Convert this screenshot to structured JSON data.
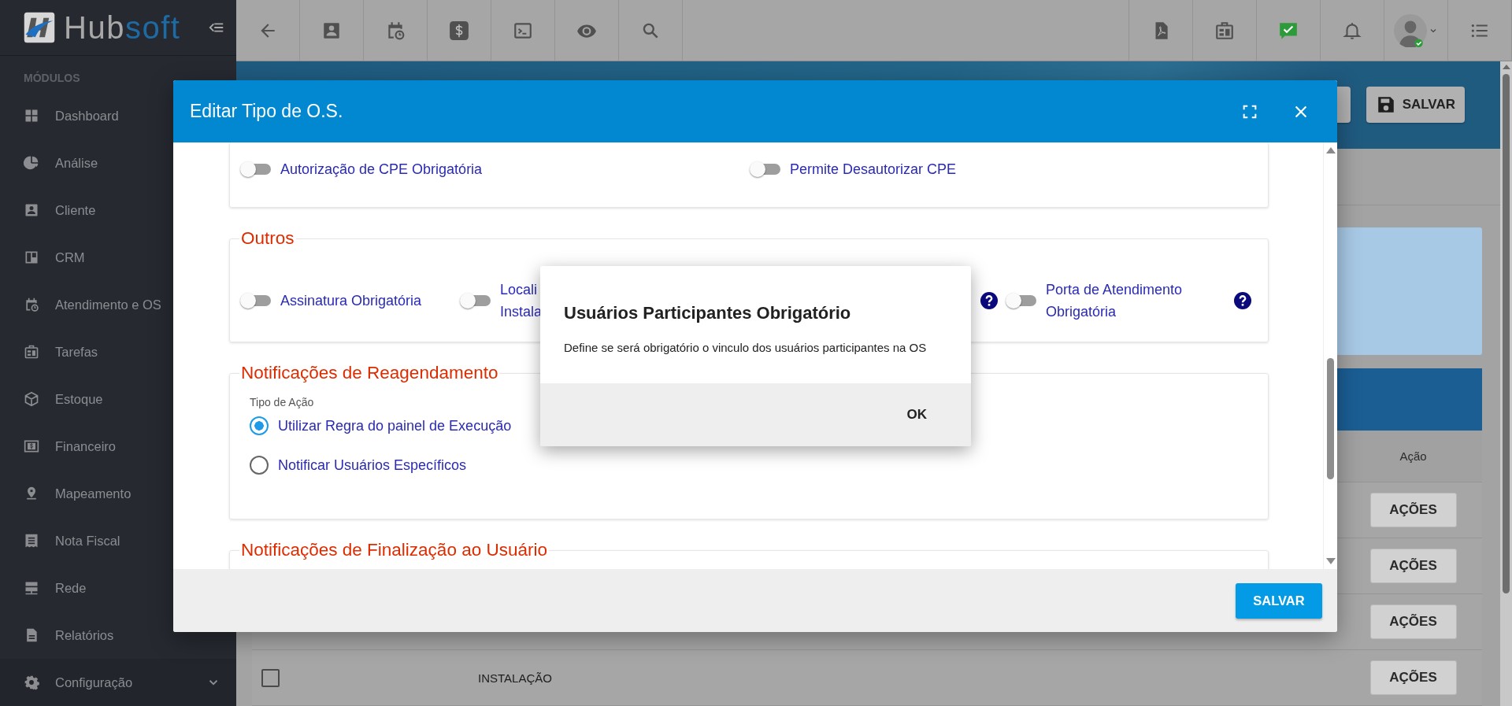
{
  "sidebar": {
    "brand": [
      "Hub",
      "soft"
    ],
    "section_label": "MÓDULOS",
    "items": [
      {
        "label": "Dashboard",
        "kind": "link"
      },
      {
        "label": "Análise",
        "kind": "link"
      },
      {
        "label": "Cliente",
        "kind": "link"
      },
      {
        "label": "CRM",
        "kind": "link"
      },
      {
        "label": "Atendimento e OS",
        "kind": "link"
      },
      {
        "label": "Tarefas",
        "kind": "link"
      },
      {
        "label": "Estoque",
        "kind": "link"
      },
      {
        "label": "Financeiro",
        "kind": "link"
      },
      {
        "label": "Mapeamento",
        "kind": "link"
      },
      {
        "label": "Nota Fiscal",
        "kind": "link"
      },
      {
        "label": "Rede",
        "kind": "link"
      },
      {
        "label": "Relatórios",
        "kind": "link"
      },
      {
        "label": "Configuração",
        "kind": "group",
        "expanded": false
      }
    ]
  },
  "page": {
    "save_button": "SALVAR",
    "table": {
      "action_column": "Ação",
      "rows": [
        {
          "action": "AÇÕES"
        },
        {
          "action": "AÇÕES"
        },
        {
          "action": "AÇÕES"
        },
        {
          "checked": false,
          "name": "INSTALAÇÃO",
          "action": "AÇÕES"
        }
      ]
    }
  },
  "modal": {
    "title": "Editar Tipo de O.S.",
    "sections": [
      {
        "kind": "toggles",
        "toggles": [
          {
            "label": "Autorização de CPE Obrigatória",
            "on": false,
            "help": false
          },
          {
            "label": "Permite Desautorizar CPE",
            "on": false,
            "help": false
          }
        ]
      },
      {
        "kind": "toggles",
        "legend": "Outros",
        "toggles": [
          {
            "label": "Assinatura Obrigatória",
            "on": false,
            "help": false
          },
          {
            "label": "Locali\nInstala",
            "on": false,
            "help": true
          },
          {
            "label": "Porta de Atendimento Obrigatória",
            "on": false,
            "help": true
          }
        ]
      },
      {
        "kind": "radios",
        "legend": "Notificações de Reagendamento",
        "field_label": "Tipo de Ação",
        "options": [
          {
            "label": "Utilizar Regra do painel de Execução",
            "selected": true
          },
          {
            "label": "Notificar Usuários Específicos",
            "selected": false
          }
        ]
      },
      {
        "kind": "empty",
        "legend": "Notificações de Finalização ao Usuário"
      }
    ],
    "save_button": "SALVAR"
  },
  "dialog": {
    "title": "Usuários Participantes Obrigatório",
    "message": "Define se será obrigatório o vinculo dos usuários participantes na OS",
    "button": "OK"
  }
}
